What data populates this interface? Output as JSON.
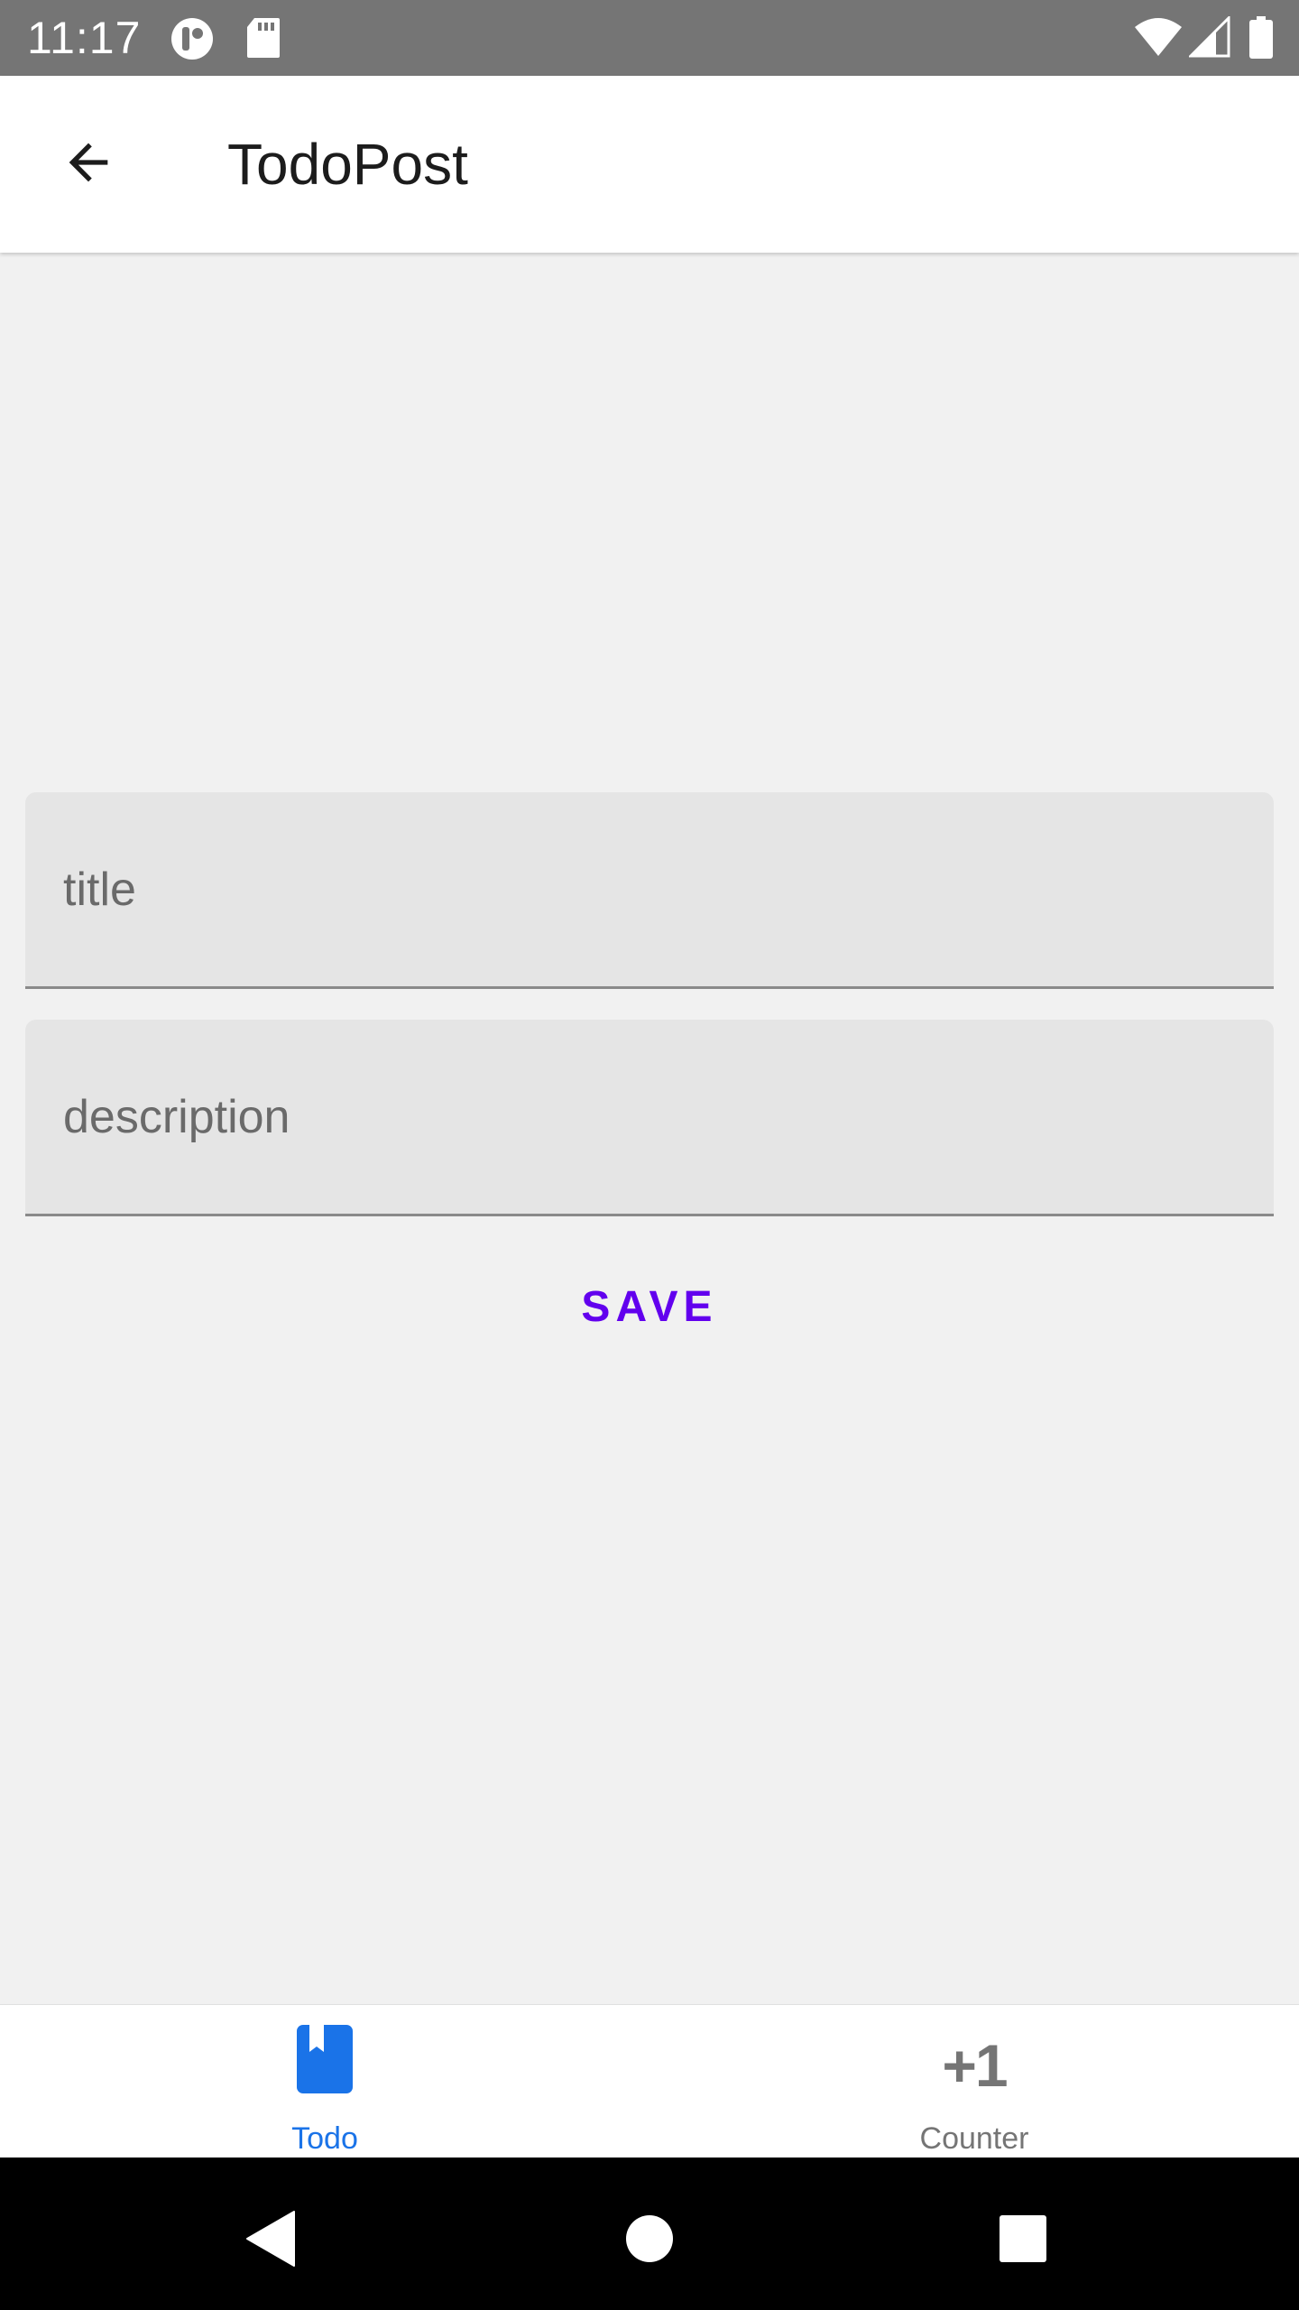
{
  "status_bar": {
    "time": "11:17",
    "icons": [
      "alert-circle-icon",
      "sd-card-icon",
      "wifi-icon",
      "signal-icon",
      "battery-icon"
    ]
  },
  "app_bar": {
    "title": "TodoPost",
    "back_icon": "arrow-back-icon"
  },
  "form": {
    "title_field": {
      "placeholder": "title",
      "value": ""
    },
    "description_field": {
      "placeholder": "description",
      "value": ""
    },
    "save_label": "SAVE"
  },
  "bottom_nav": {
    "items": [
      {
        "label": "Todo",
        "icon": "bookmark-icon",
        "selected": true
      },
      {
        "label": "Counter",
        "icon": "plus-one-icon",
        "icon_text": "+1",
        "selected": false
      }
    ]
  },
  "system_nav": {
    "buttons": [
      "back-triangle-icon",
      "home-circle-icon",
      "recents-square-icon"
    ]
  },
  "colors": {
    "status_bar": "#757575",
    "app_bar": "#ffffff",
    "background": "#f1f1f1",
    "field_fill": "#e5e5e5",
    "accent": "#6200ee",
    "nav_selected": "#1a73e8",
    "nav_unselected": "#757575"
  }
}
